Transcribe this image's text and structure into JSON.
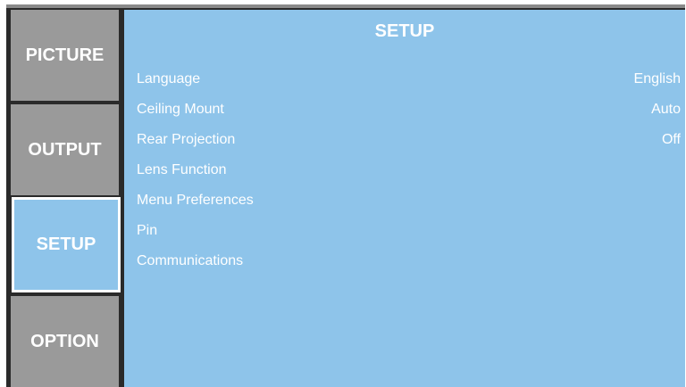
{
  "tabs": [
    {
      "label": "PICTURE",
      "active": false
    },
    {
      "label": "OUTPUT",
      "active": false
    },
    {
      "label": "SETUP",
      "active": true
    },
    {
      "label": "OPTION",
      "active": false
    }
  ],
  "panel": {
    "title": "SETUP",
    "items": [
      {
        "label": "Language",
        "value": "English"
      },
      {
        "label": "Ceiling Mount",
        "value": "Auto"
      },
      {
        "label": "Rear Projection",
        "value": "Off"
      },
      {
        "label": "Lens Function",
        "value": ""
      },
      {
        "label": "Menu Preferences",
        "value": ""
      },
      {
        "label": "Pin",
        "value": ""
      },
      {
        "label": "Communications",
        "value": ""
      }
    ]
  },
  "colors": {
    "panel_background": "#8ec4ea",
    "inactive_tab": "#9a9a9a",
    "frame": "#2a2a2a",
    "text": "#ffffff"
  }
}
